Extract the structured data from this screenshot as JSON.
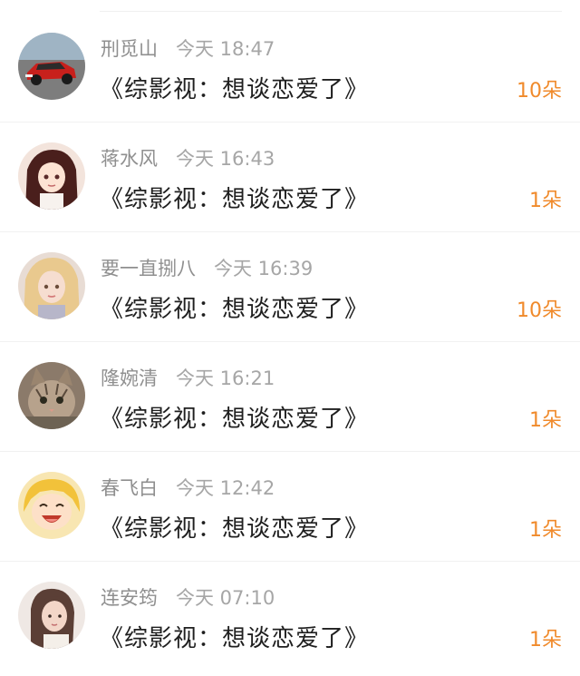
{
  "gift_list": {
    "items": [
      {
        "name": "刑觅山",
        "time": "今天 18:47",
        "title": "《综影视：想谈恋爱了》",
        "count": "10朵",
        "avatar_icon": "red-car-avatar"
      },
      {
        "name": "蒋水风",
        "time": "今天 16:43",
        "title": "《综影视：想谈恋爱了》",
        "count": "1朵",
        "avatar_icon": "anime-girl-avatar"
      },
      {
        "name": "要一直捌八",
        "time": "今天 16:39",
        "title": "《综影视：想谈恋爱了》",
        "count": "10朵",
        "avatar_icon": "blonde-girl-avatar"
      },
      {
        "name": "隆婉清",
        "time": "今天 16:21",
        "title": "《综影视：想谈恋爱了》",
        "count": "1朵",
        "avatar_icon": "cat-avatar"
      },
      {
        "name": "春飞白",
        "time": "今天 12:42",
        "title": "《综影视：想谈恋爱了》",
        "count": "1朵",
        "avatar_icon": "laughing-cartoon-avatar"
      },
      {
        "name": "连安筠",
        "time": "今天 07:10",
        "title": "《综影视：想谈恋爱了》",
        "count": "1朵",
        "avatar_icon": "portrait-woman-avatar"
      }
    ]
  },
  "colors": {
    "accent": "#f08a2b",
    "username": "#8f8f8f",
    "title_text": "#1f1f1f",
    "divider": "#f1f1f1"
  }
}
